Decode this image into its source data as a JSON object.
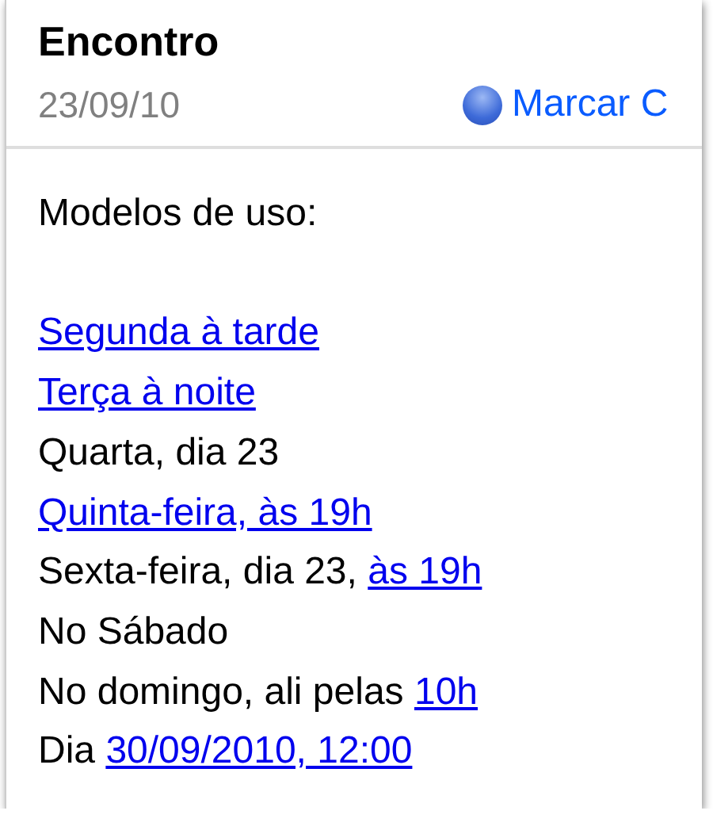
{
  "header": {
    "title": "Encontro",
    "date": "23/09/10",
    "action": "Marcar C"
  },
  "body": [
    {
      "kind": "intro",
      "segments": [
        {
          "kind": "text",
          "text": "Modelos de uso:"
        }
      ]
    },
    {
      "kind": "line",
      "segments": [
        {
          "kind": "link",
          "text": "Segunda à tarde"
        }
      ]
    },
    {
      "kind": "line",
      "segments": [
        {
          "kind": "link",
          "text": "Terça à noite"
        }
      ]
    },
    {
      "kind": "line",
      "segments": [
        {
          "kind": "text",
          "text": "Quarta, dia 23"
        }
      ]
    },
    {
      "kind": "line",
      "segments": [
        {
          "kind": "link",
          "text": "Quinta-feira, às 19h"
        }
      ]
    },
    {
      "kind": "line",
      "segments": [
        {
          "kind": "text",
          "text": "Sexta-feira, dia 23, "
        },
        {
          "kind": "link",
          "text": "às 19h"
        }
      ]
    },
    {
      "kind": "line",
      "segments": [
        {
          "kind": "text",
          "text": "No Sábado"
        }
      ]
    },
    {
      "kind": "line",
      "segments": [
        {
          "kind": "text",
          "text": "No domingo, ali pelas "
        },
        {
          "kind": "link",
          "text": "10h"
        }
      ]
    },
    {
      "kind": "line",
      "segments": [
        {
          "kind": "text",
          "text": "Dia "
        },
        {
          "kind": "link",
          "text": "30/09/2010, 12:00"
        }
      ]
    }
  ]
}
